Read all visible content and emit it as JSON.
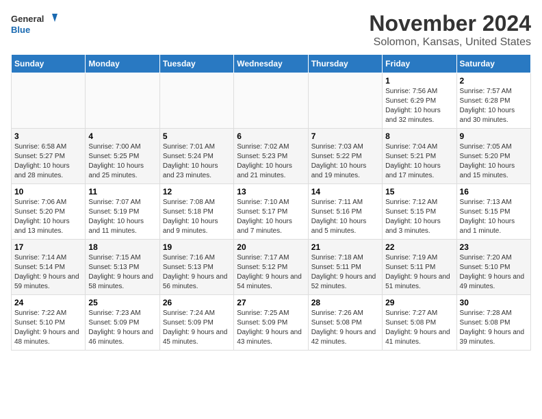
{
  "header": {
    "logo_line1": "General",
    "logo_line2": "Blue",
    "month": "November 2024",
    "location": "Solomon, Kansas, United States"
  },
  "days_of_week": [
    "Sunday",
    "Monday",
    "Tuesday",
    "Wednesday",
    "Thursday",
    "Friday",
    "Saturday"
  ],
  "weeks": [
    [
      {
        "day": "",
        "info": ""
      },
      {
        "day": "",
        "info": ""
      },
      {
        "day": "",
        "info": ""
      },
      {
        "day": "",
        "info": ""
      },
      {
        "day": "",
        "info": ""
      },
      {
        "day": "1",
        "info": "Sunrise: 7:56 AM\nSunset: 6:29 PM\nDaylight: 10 hours and 32 minutes."
      },
      {
        "day": "2",
        "info": "Sunrise: 7:57 AM\nSunset: 6:28 PM\nDaylight: 10 hours and 30 minutes."
      }
    ],
    [
      {
        "day": "3",
        "info": "Sunrise: 6:58 AM\nSunset: 5:27 PM\nDaylight: 10 hours and 28 minutes."
      },
      {
        "day": "4",
        "info": "Sunrise: 7:00 AM\nSunset: 5:25 PM\nDaylight: 10 hours and 25 minutes."
      },
      {
        "day": "5",
        "info": "Sunrise: 7:01 AM\nSunset: 5:24 PM\nDaylight: 10 hours and 23 minutes."
      },
      {
        "day": "6",
        "info": "Sunrise: 7:02 AM\nSunset: 5:23 PM\nDaylight: 10 hours and 21 minutes."
      },
      {
        "day": "7",
        "info": "Sunrise: 7:03 AM\nSunset: 5:22 PM\nDaylight: 10 hours and 19 minutes."
      },
      {
        "day": "8",
        "info": "Sunrise: 7:04 AM\nSunset: 5:21 PM\nDaylight: 10 hours and 17 minutes."
      },
      {
        "day": "9",
        "info": "Sunrise: 7:05 AM\nSunset: 5:20 PM\nDaylight: 10 hours and 15 minutes."
      }
    ],
    [
      {
        "day": "10",
        "info": "Sunrise: 7:06 AM\nSunset: 5:20 PM\nDaylight: 10 hours and 13 minutes."
      },
      {
        "day": "11",
        "info": "Sunrise: 7:07 AM\nSunset: 5:19 PM\nDaylight: 10 hours and 11 minutes."
      },
      {
        "day": "12",
        "info": "Sunrise: 7:08 AM\nSunset: 5:18 PM\nDaylight: 10 hours and 9 minutes."
      },
      {
        "day": "13",
        "info": "Sunrise: 7:10 AM\nSunset: 5:17 PM\nDaylight: 10 hours and 7 minutes."
      },
      {
        "day": "14",
        "info": "Sunrise: 7:11 AM\nSunset: 5:16 PM\nDaylight: 10 hours and 5 minutes."
      },
      {
        "day": "15",
        "info": "Sunrise: 7:12 AM\nSunset: 5:15 PM\nDaylight: 10 hours and 3 minutes."
      },
      {
        "day": "16",
        "info": "Sunrise: 7:13 AM\nSunset: 5:15 PM\nDaylight: 10 hours and 1 minute."
      }
    ],
    [
      {
        "day": "17",
        "info": "Sunrise: 7:14 AM\nSunset: 5:14 PM\nDaylight: 9 hours and 59 minutes."
      },
      {
        "day": "18",
        "info": "Sunrise: 7:15 AM\nSunset: 5:13 PM\nDaylight: 9 hours and 58 minutes."
      },
      {
        "day": "19",
        "info": "Sunrise: 7:16 AM\nSunset: 5:13 PM\nDaylight: 9 hours and 56 minutes."
      },
      {
        "day": "20",
        "info": "Sunrise: 7:17 AM\nSunset: 5:12 PM\nDaylight: 9 hours and 54 minutes."
      },
      {
        "day": "21",
        "info": "Sunrise: 7:18 AM\nSunset: 5:11 PM\nDaylight: 9 hours and 52 minutes."
      },
      {
        "day": "22",
        "info": "Sunrise: 7:19 AM\nSunset: 5:11 PM\nDaylight: 9 hours and 51 minutes."
      },
      {
        "day": "23",
        "info": "Sunrise: 7:20 AM\nSunset: 5:10 PM\nDaylight: 9 hours and 49 minutes."
      }
    ],
    [
      {
        "day": "24",
        "info": "Sunrise: 7:22 AM\nSunset: 5:10 PM\nDaylight: 9 hours and 48 minutes."
      },
      {
        "day": "25",
        "info": "Sunrise: 7:23 AM\nSunset: 5:09 PM\nDaylight: 9 hours and 46 minutes."
      },
      {
        "day": "26",
        "info": "Sunrise: 7:24 AM\nSunset: 5:09 PM\nDaylight: 9 hours and 45 minutes."
      },
      {
        "day": "27",
        "info": "Sunrise: 7:25 AM\nSunset: 5:09 PM\nDaylight: 9 hours and 43 minutes."
      },
      {
        "day": "28",
        "info": "Sunrise: 7:26 AM\nSunset: 5:08 PM\nDaylight: 9 hours and 42 minutes."
      },
      {
        "day": "29",
        "info": "Sunrise: 7:27 AM\nSunset: 5:08 PM\nDaylight: 9 hours and 41 minutes."
      },
      {
        "day": "30",
        "info": "Sunrise: 7:28 AM\nSunset: 5:08 PM\nDaylight: 9 hours and 39 minutes."
      }
    ]
  ]
}
